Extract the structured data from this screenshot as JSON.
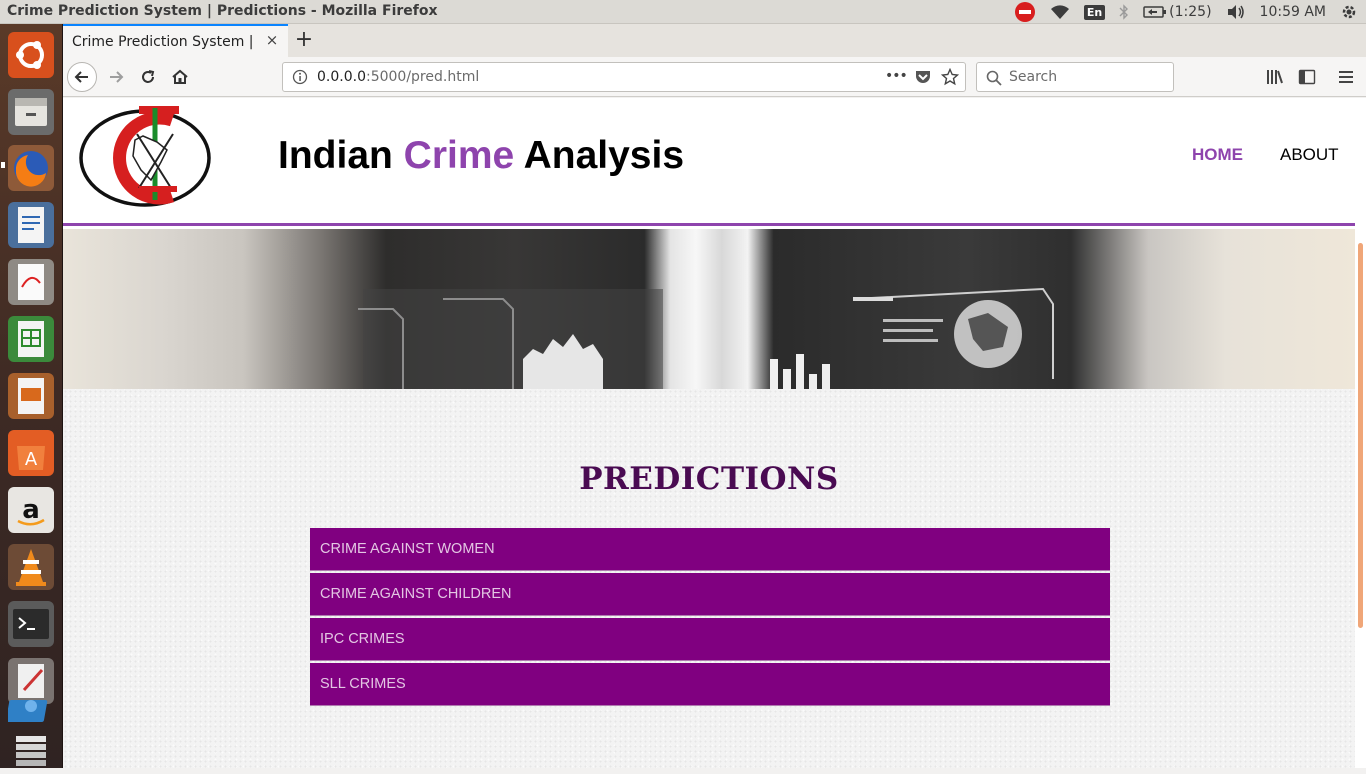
{
  "window": {
    "title": "Crime Prediction System | Predictions - Mozilla Firefox"
  },
  "tray": {
    "keyboard": "En",
    "battery": "(1:25)",
    "clock": "10:59 AM",
    "icons": [
      "stop-icon",
      "wifi-icon",
      "keyboard-icon",
      "bluetooth-icon",
      "battery-icon",
      "volume-icon",
      "settings-gear-icon"
    ]
  },
  "launcher": {
    "items": [
      "ubuntu-dash",
      "files",
      "firefox",
      "libreoffice-writer",
      "document-viewer",
      "libreoffice-calc",
      "libreoffice-impress",
      "software-center",
      "amazon",
      "vlc",
      "terminal",
      "text-editor",
      "workspace-switcher",
      "trash"
    ]
  },
  "browser": {
    "tab_title": "Crime Prediction System | Predictions",
    "tab_close": "×",
    "new_tab": "+",
    "url_host": "0.0.0.0",
    "url_rest": ":5000/pred.html",
    "search_placeholder": "Search",
    "page_actions": "•••"
  },
  "site": {
    "title_part1": "Indian ",
    "title_accent": "Crime",
    "title_part2": " Analysis",
    "nav": {
      "home": "HOME",
      "about": "ABOUT"
    },
    "accent_color": "#8e44ad"
  },
  "predictions": {
    "heading": "PREDICTIONS",
    "item_color": "#800080",
    "items": [
      "CRIME AGAINST WOMEN",
      "CRIME AGAINST CHILDREN",
      "IPC CRIMES",
      "SLL CRIMES"
    ]
  }
}
